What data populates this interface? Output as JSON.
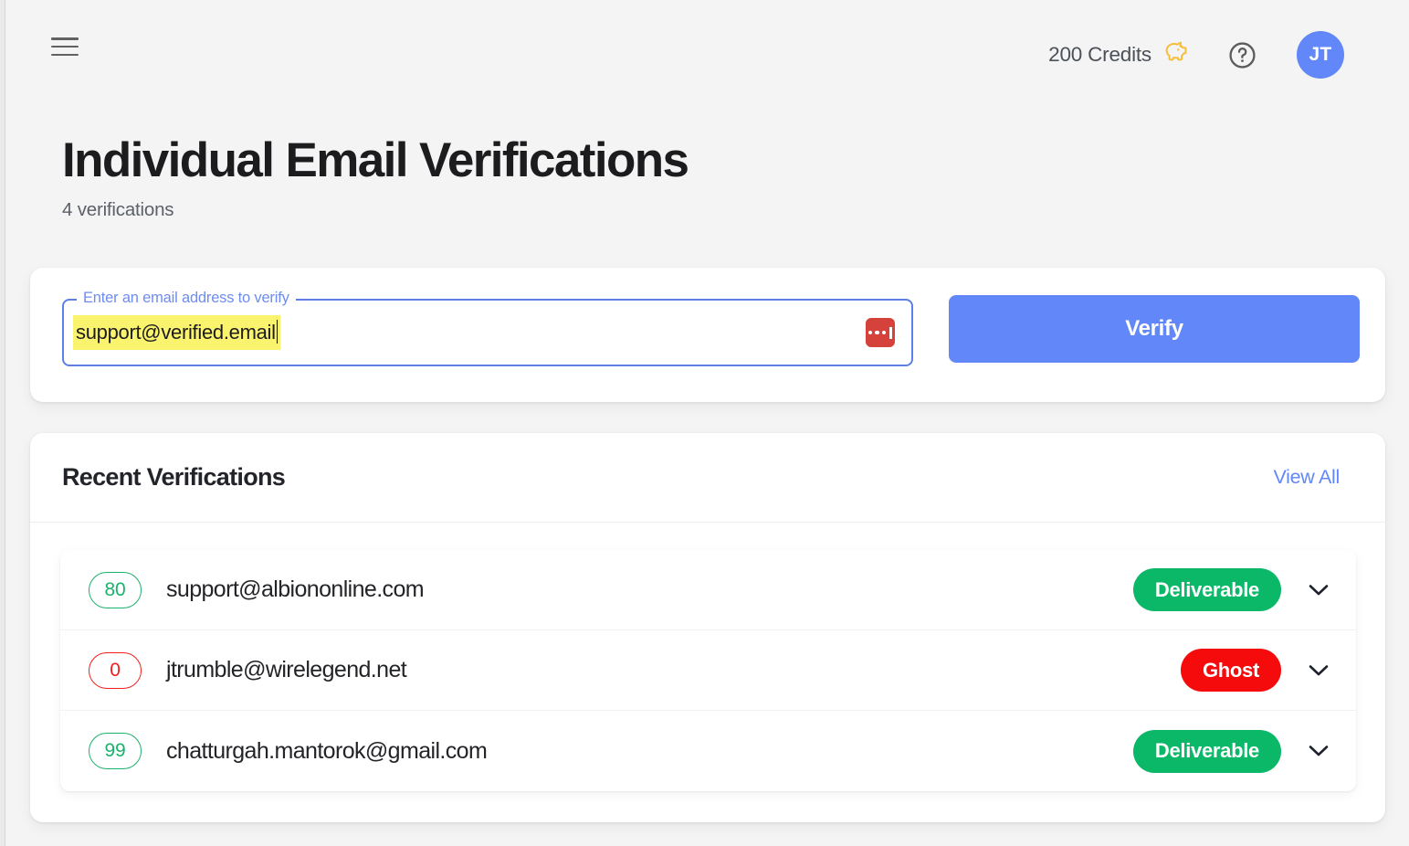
{
  "topbar": {
    "menu_icon": "hamburger-menu-icon",
    "credits_label": "200 Credits",
    "credits_icon": "piggy-bank-icon",
    "help_icon": "help-circle-icon",
    "avatar_initials": "JT"
  },
  "header": {
    "title": "Individual Email Verifications",
    "subtitle": "4 verifications"
  },
  "verify_form": {
    "field_legend": "Enter an email address to verify",
    "email_value": "support@verified.email",
    "email_placeholder": "",
    "password_manager_icon": "lastpass-icon",
    "verify_button_label": "Verify"
  },
  "recent": {
    "title": "Recent Verifications",
    "view_all_label": "View All",
    "rows": [
      {
        "score": "80",
        "score_color": "#19b36b",
        "email": "support@albiononline.com",
        "status": "Deliverable",
        "status_color": "#0bb868",
        "chevron_icon": "chevron-down-icon"
      },
      {
        "score": "0",
        "score_color": "#f21f1f",
        "email": "jtrumble@wirelegend.net",
        "status": "Ghost",
        "status_color": "#f50b0b",
        "chevron_icon": "chevron-down-icon"
      },
      {
        "score": "99",
        "score_color": "#19b36b",
        "email": "chatturgah.mantorok@gmail.com",
        "status": "Deliverable",
        "status_color": "#0bb868",
        "chevron_icon": "chevron-down-icon"
      }
    ]
  },
  "colors": {
    "accent_blue": "#6287f8",
    "page_background": "#f4f4f4",
    "card_background": "#ffffff",
    "highlight_yellow": "#faf36e",
    "lastpass_red": "#d5413b",
    "credits_yellow": "#f5bd3c"
  }
}
